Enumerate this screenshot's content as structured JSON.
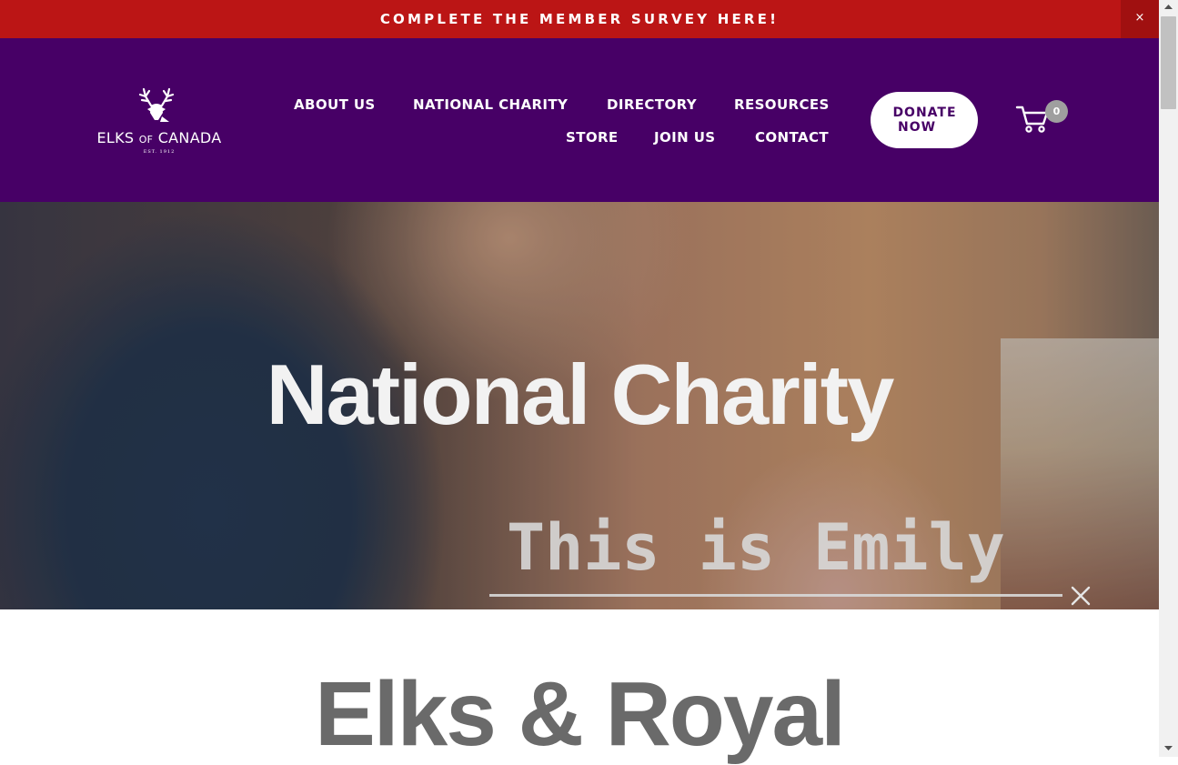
{
  "survey": {
    "text": "COMPLETE THE MEMBER SURVEY HERE!",
    "close_label": "×",
    "color": "#bb1515"
  },
  "header": {
    "background": "#470066",
    "logo": {
      "name_part1": "ELKS",
      "name_part2": "OF",
      "name_part3": "CANADA",
      "established": "EST. 1912",
      "icon": "elk-head-icon"
    },
    "nav": {
      "about": "ABOUT US",
      "charity": "NATIONAL CHARITY",
      "directory": "DIRECTORY",
      "resources": "RESOURCES",
      "store": "STORE",
      "join": "JOIN US",
      "contact": "CONTACT"
    },
    "donate": {
      "line1": "DONATE",
      "line2": "NOW"
    },
    "cart": {
      "icon": "shopping-cart-icon",
      "count": "0"
    }
  },
  "hero": {
    "title": "National Charity",
    "video_caption": "This is Emily",
    "close_icon": "close-icon"
  },
  "section": {
    "title": "Elks & Royal"
  }
}
